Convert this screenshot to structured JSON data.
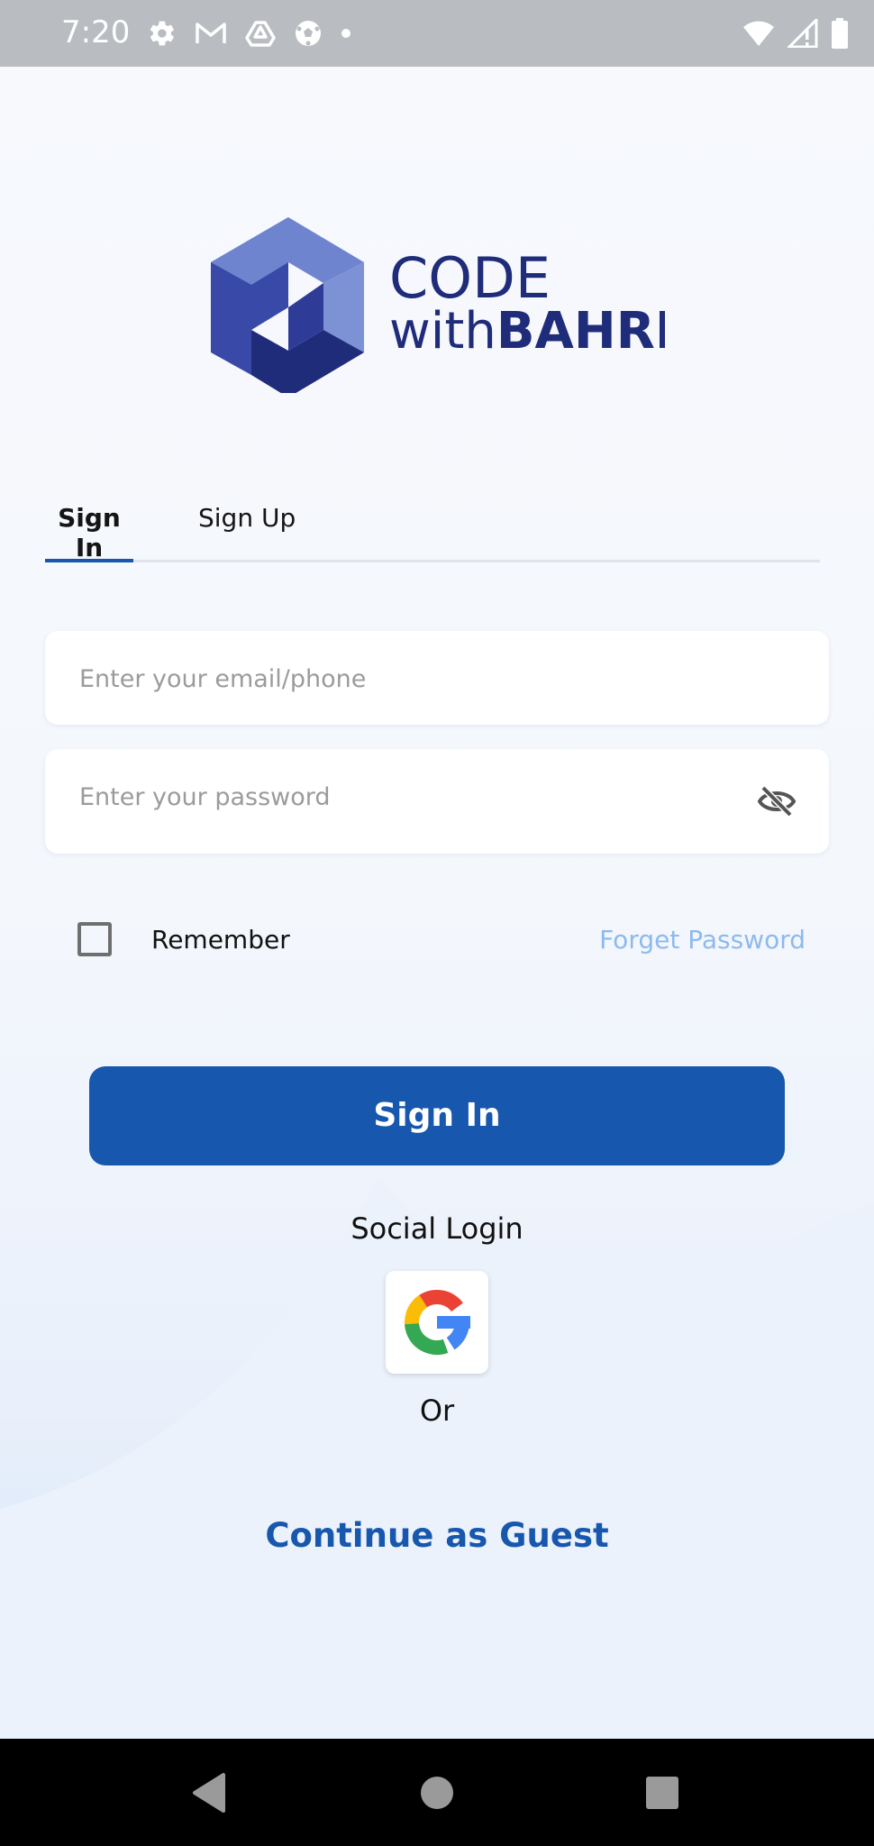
{
  "status_bar": {
    "time": "7:20",
    "left_icons": [
      "gear-icon",
      "gmail-icon",
      "drive-icon",
      "soccer-ball-icon",
      "dot-icon"
    ],
    "right_icons": [
      "wifi-icon",
      "signal-icon",
      "battery-icon"
    ]
  },
  "logo": {
    "line1": "CODE",
    "line2_light": "with",
    "line2_bold": "BAHRI",
    "colors": {
      "dark": "#1f2c7a",
      "mid": "#3849a8",
      "light": "#7c92d4"
    }
  },
  "tabs": [
    {
      "label": "Sign In",
      "active": true
    },
    {
      "label": "Sign Up",
      "active": false
    }
  ],
  "form": {
    "email_placeholder": "Enter your email/phone",
    "email_value": "",
    "password_placeholder": "Enter your password",
    "password_value": "",
    "remember_label": "Remember",
    "remember_checked": false,
    "forget_label": "Forget Password"
  },
  "signin_button_label": "Sign In",
  "social": {
    "title": "Social Login",
    "google_icon": "google-icon"
  },
  "or_label": "Or",
  "guest_label": "Continue as Guest",
  "nav_bar": {
    "icons": [
      "back-triangle-icon",
      "home-circle-icon",
      "recents-square-icon"
    ]
  },
  "colors": {
    "primary": "#1757ae",
    "link_light": "#8cbaf0",
    "status_bar": "#b9bcc0"
  }
}
